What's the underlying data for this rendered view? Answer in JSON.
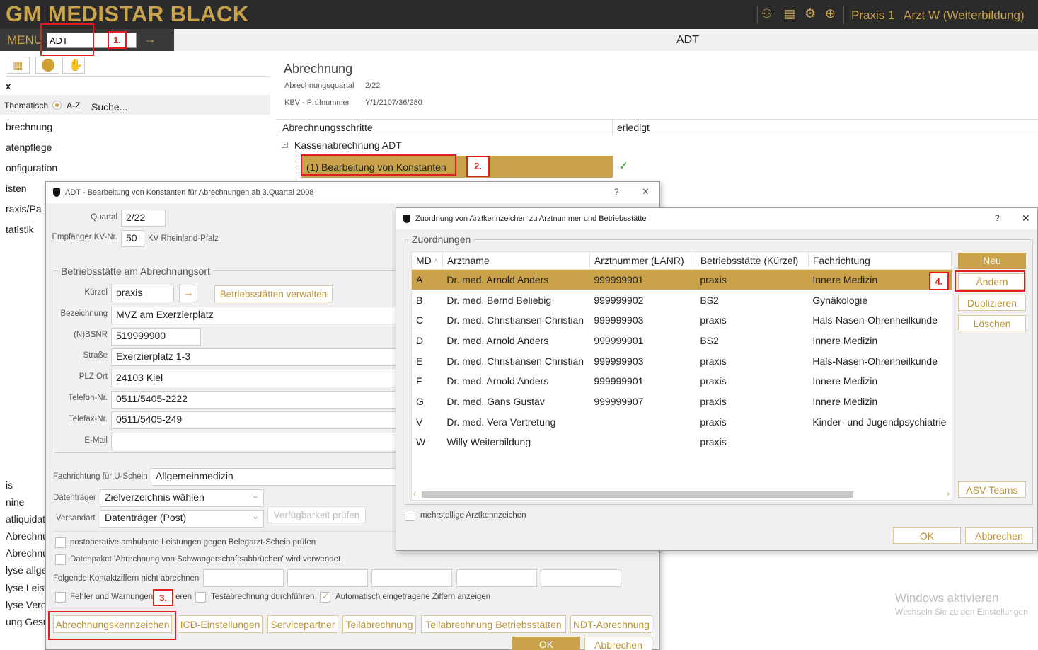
{
  "app": {
    "title": "GM MEDISTAR BLACK",
    "top_icons": [
      "people-icon",
      "book-icon",
      "settings-cog-icon",
      "globe-icon"
    ],
    "practice": "Praxis 1",
    "user": "Arzt W (Weiterbildung)",
    "menu_label": "MENU",
    "menu_input": "ADT",
    "center_title": "ADT"
  },
  "sidebar": {
    "tool_icons": [
      "grid-icon",
      "coin-icon",
      "hand-icon"
    ],
    "header": "x",
    "radio_thematisch": "Thematisch",
    "radio_az": "A-Z",
    "search": "Suche...",
    "items_top": [
      "brechnung",
      "atenpflege",
      "onfiguration",
      "isten",
      "raxis/Pa",
      "tatistik"
    ],
    "items_bottom": [
      "is",
      "nine",
      "atliquidat",
      "Abrechnu",
      "Abrechnu",
      "lyse allge",
      "lyse Leist",
      "lyse Vero",
      "ung Gesu"
    ]
  },
  "abrechnung": {
    "title": "Abrechnung",
    "quartal_label": "Abrechnungsquartal",
    "quartal_value": "2/22",
    "kbv_label": "KBV - Prüfnummer",
    "kbv_value": "Y/1/2107/36/280",
    "col_steps": "Abrechnungsschritte",
    "col_done": "erledigt",
    "group": "Kassenabrechnung ADT",
    "step1": "(1) Bearbeitung von Konstanten",
    "check": "✓"
  },
  "adt_dialog": {
    "title": "ADT - Bearbeitung von Konstanten für Abrechnungen ab 3.Quartal 2008",
    "help": "?",
    "close": "✕",
    "quartal_label": "Quartal",
    "quartal_value": "2/22",
    "empf_label": "Empfänger KV-Nr.",
    "empf_value": "50",
    "empf_name": "KV Rheinland-Pfalz",
    "group_label": "Betriebsstätte am Abrechnungsort",
    "kuerzel_label": "Kürzel",
    "kuerzel_value": "praxis",
    "arrow": "→",
    "verwalten": "Betriebsstätten verwalten",
    "bez_label": "Bezeichnung",
    "bez_value": "MVZ am Exerzierplatz",
    "bsnr_label": "(N)BSNR",
    "bsnr_value": "519999900",
    "strasse_label": "Straße",
    "strasse_value": "Exerzierplatz 1-3",
    "plz_label": "PLZ Ort",
    "plz_value": "24103 Kiel",
    "tel_label": "Telefon-Nr.",
    "tel_value": "0511/5405-2222",
    "fax_label": "Telefax-Nr.",
    "fax_value": "0511/5405-249",
    "mail_label": "E-Mail",
    "mail_value": "",
    "fach_label": "Fachrichtung für U-Schein",
    "fach_value": "Allgemeinmedizin",
    "dt_label": "Datenträger",
    "dt_value": "Zielverzeichnis wählen",
    "vs_label": "Versandart",
    "vs_value": "Datenträger (Post)",
    "verfueg": "Verfügbarkeit prüfen",
    "chk1": "postoperative ambulante Leistungen gegen Belegarzt-Schein prüfen",
    "chk2": "Datenpaket 'Abrechnung von Schwangerschaftsabbrüchen' wird verwendet",
    "kontakt_label": "Folgende Kontaktziffern nicht abrechnen",
    "chk3a": "Fehler und Warnungen g",
    "chk3b": "eren",
    "chk4": "Testabrechnung durchführen",
    "chk5": "Automatisch eingetragene Ziffern anzeigen",
    "tabs": [
      "Abrechnungskennzeichen",
      "ICD-Einstellungen",
      "Servicepartner",
      "Teilabrechnung",
      "Teilabrechnung Betriebsstätten",
      "NDT-Abrechnung"
    ],
    "ok": "OK",
    "cancel": "Abbrechen"
  },
  "zuord_dialog": {
    "title": "Zuordnung von Arztkennzeichen zu Arztnummer und Betriebsstätte",
    "help": "?",
    "close": "✕",
    "group_label": "Zuordnungen",
    "columns": [
      "MD",
      "Arztname",
      "Arztnummer (LANR)",
      "Betriebsstätte (Kürzel)",
      "Fachrichtung"
    ],
    "sort_indicator": "^",
    "rows": [
      [
        "A",
        "Dr. med. Arnold Anders",
        "999999901",
        "praxis",
        "Innere Medizin"
      ],
      [
        "B",
        "Dr. med. Bernd Beliebig",
        "999999902",
        "BS2",
        "Gynäkologie"
      ],
      [
        "C",
        "Dr. med. Christiansen Christian",
        "999999903",
        "praxis",
        "Hals-Nasen-Ohrenheilkunde"
      ],
      [
        "D",
        "Dr. med. Arnold Anders",
        "999999901",
        "BS2",
        "Innere Medizin"
      ],
      [
        "E",
        "Dr. med. Christiansen Christian",
        "999999903",
        "praxis",
        "Hals-Nasen-Ohrenheilkunde"
      ],
      [
        "F",
        "Dr. med. Arnold Anders",
        "999999901",
        "praxis",
        "Innere Medizin"
      ],
      [
        "G",
        "Dr. med. Gans Gustav",
        "999999907",
        "praxis",
        "Innere Medizin"
      ],
      [
        "V",
        "Dr. med. Vera Vertretung",
        "",
        "praxis",
        "Kinder- und Jugendpsychiatrie"
      ],
      [
        "W",
        "Willy Weiterbildung",
        "",
        "praxis",
        ""
      ]
    ],
    "btn_neu": "Neu",
    "btn_aendern": "Ändern",
    "btn_dup": "Duplizieren",
    "btn_del": "Löschen",
    "btn_asv": "ASV-Teams",
    "mehrstellig": "mehrstellige Arztkennzeichen",
    "ok": "OK",
    "cancel": "Abbrechen"
  },
  "annotations": [
    "1.",
    "2.",
    "3.",
    "4."
  ],
  "watermark": {
    "line1": "Windows aktivieren",
    "line2": "Wechseln Sie zu den Einstellungen"
  },
  "colors": {
    "accent": "#c9a24a",
    "header_bg": "#2b2b2b",
    "menu_bar": "#3a3a3a",
    "annotation": "#e02020"
  }
}
